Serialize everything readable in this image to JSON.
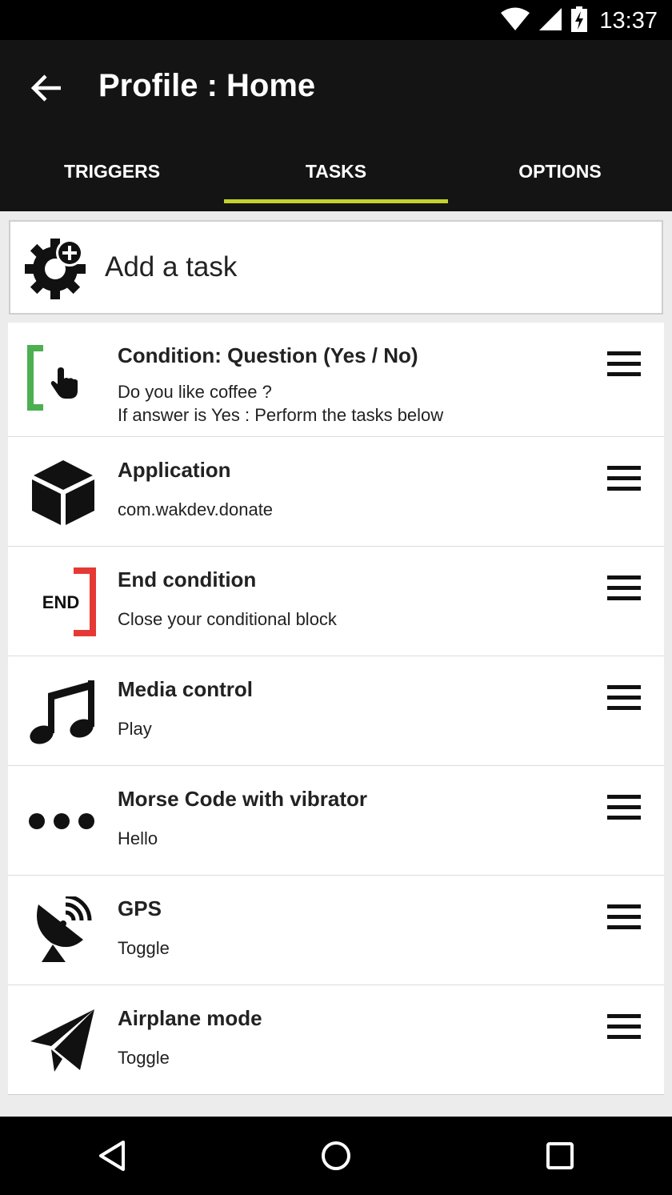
{
  "status_bar": {
    "time": "13:37"
  },
  "app_bar": {
    "title": "Profile : Home"
  },
  "tabs": [
    {
      "label": "TRIGGERS",
      "active": false
    },
    {
      "label": "TASKS",
      "active": true
    },
    {
      "label": "OPTIONS",
      "active": false
    }
  ],
  "add_task": {
    "label": "Add a task"
  },
  "tasks": [
    {
      "title": "Condition: Question (Yes / No)",
      "line1": "Do you like coffee ?",
      "line2": "If answer is Yes : Perform the tasks below",
      "icon": "condition-question-icon"
    },
    {
      "title": "Application",
      "line1": "com.wakdev.donate",
      "icon": "cube-icon"
    },
    {
      "title": "End condition",
      "line1": "Close your conditional block",
      "icon": "end-condition-icon",
      "icon_text": "END"
    },
    {
      "title": "Media control",
      "line1": "Play",
      "icon": "music-note-icon"
    },
    {
      "title": "Morse Code with vibrator",
      "line1": "Hello",
      "icon": "dots-icon"
    },
    {
      "title": "GPS",
      "line1": "Toggle",
      "icon": "satellite-dish-icon"
    },
    {
      "title": "Airplane mode",
      "line1": "Toggle",
      "icon": "paper-plane-icon"
    }
  ],
  "colors": {
    "accent": "#c3d32d",
    "condition_green": "#4caf50",
    "end_red": "#e53935",
    "toolbar": "#141414"
  }
}
